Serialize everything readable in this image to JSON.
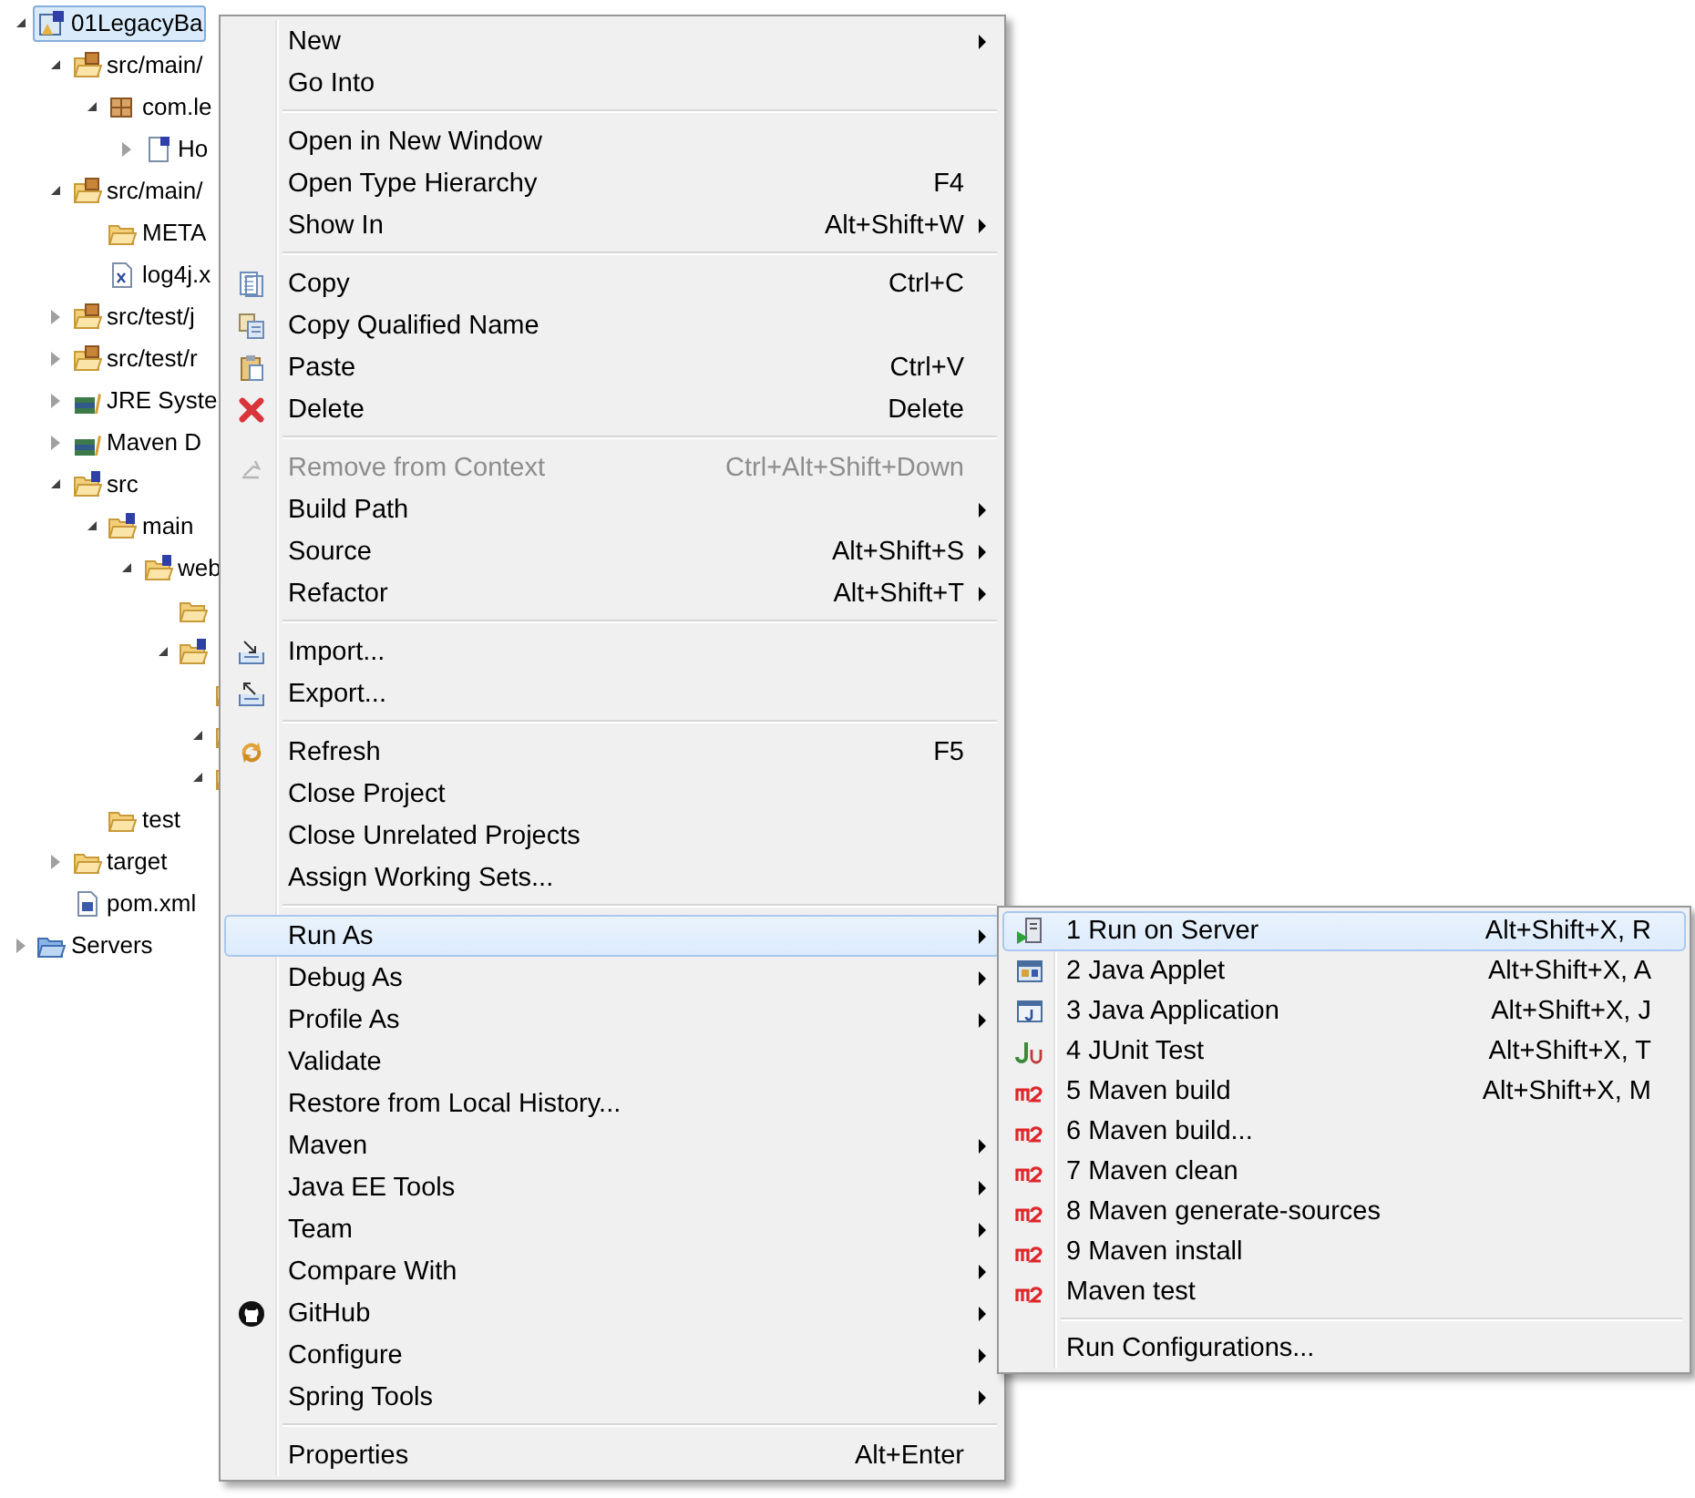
{
  "tree": [
    {
      "label": "01LegacyBa",
      "kind": "project",
      "expanded": true,
      "selected": true,
      "children": [
        {
          "label": "src/main/",
          "kind": "package-folder",
          "expanded": true,
          "selected": false,
          "children": [
            {
              "label": "com.le",
              "kind": "package",
              "expanded": true,
              "selected": false,
              "children": [
                {
                  "label": "Ho",
                  "kind": "java-file",
                  "expanded": false,
                  "selected": false
                }
              ]
            }
          ]
        },
        {
          "label": "src/main/",
          "kind": "package-folder",
          "expanded": true,
          "selected": false,
          "children": [
            {
              "label": "META",
              "kind": "folder",
              "selected": false
            },
            {
              "label": "log4j.x",
              "kind": "xml-file",
              "selected": false
            }
          ]
        },
        {
          "label": "src/test/j",
          "kind": "package-folder",
          "expanded": false,
          "selected": false
        },
        {
          "label": "src/test/r",
          "kind": "package-folder",
          "expanded": false,
          "selected": false
        },
        {
          "label": "JRE Syste",
          "kind": "library",
          "expanded": false,
          "selected": false
        },
        {
          "label": "Maven D",
          "kind": "library",
          "expanded": false,
          "selected": false
        },
        {
          "label": "src",
          "kind": "spring-folder",
          "expanded": true,
          "selected": false,
          "children": [
            {
              "label": "main",
              "kind": "spring-folder",
              "expanded": true,
              "selected": false,
              "children": [
                {
                  "label": "web",
                  "kind": "spring-folder",
                  "expanded": true,
                  "selected": false,
                  "children": [
                    {
                      "kind": "folder",
                      "selected": false
                    },
                    {
                      "kind": "spring-folder",
                      "expanded": true,
                      "selected": false,
                      "children": [
                        {
                          "kind": "folder",
                          "selected": false
                        },
                        {
                          "kind": "folder",
                          "expanded": true,
                          "selected": false
                        },
                        {
                          "kind": "folder",
                          "expanded": true,
                          "selected": false
                        }
                      ]
                    }
                  ]
                }
              ]
            },
            {
              "label": "test",
              "kind": "folder",
              "selected": false
            }
          ]
        },
        {
          "label": "target",
          "kind": "folder",
          "expanded": false,
          "selected": false
        },
        {
          "label": "pom.xml",
          "kind": "maven-file",
          "selected": false
        }
      ]
    },
    {
      "label": "Servers",
      "kind": "server-folder",
      "expanded": false,
      "selected": false
    }
  ],
  "menu": {
    "groups": [
      [
        {
          "label": "New",
          "submenu": true,
          "disabled": false,
          "selected": false
        },
        {
          "label": "Go Into",
          "submenu": false,
          "disabled": false,
          "selected": false
        }
      ],
      [
        {
          "label": "Open in New Window",
          "submenu": false,
          "disabled": false,
          "selected": false
        },
        {
          "label": "Open Type Hierarchy",
          "shortcut": "F4",
          "submenu": false,
          "disabled": false,
          "selected": false
        },
        {
          "label": "Show In",
          "shortcut": "Alt+Shift+W",
          "submenu": true,
          "disabled": false,
          "selected": false
        }
      ],
      [
        {
          "label": "Copy",
          "shortcut": "Ctrl+C",
          "kind": "copy",
          "submenu": false,
          "disabled": false,
          "selected": false
        },
        {
          "label": "Copy Qualified Name",
          "kind": "copy-name",
          "submenu": false,
          "disabled": false,
          "selected": false
        },
        {
          "label": "Paste",
          "shortcut": "Ctrl+V",
          "kind": "paste",
          "submenu": false,
          "disabled": false,
          "selected": false
        },
        {
          "label": "Delete",
          "shortcut": "Delete",
          "kind": "delete",
          "submenu": false,
          "disabled": false,
          "selected": false
        }
      ],
      [
        {
          "label": "Remove from Context",
          "shortcut": "Ctrl+Alt+Shift+Down",
          "kind": "remove",
          "submenu": false,
          "disabled": true,
          "selected": false
        },
        {
          "label": "Build Path",
          "submenu": true,
          "disabled": false,
          "selected": false
        },
        {
          "label": "Source",
          "shortcut": "Alt+Shift+S",
          "submenu": true,
          "disabled": false,
          "selected": false
        },
        {
          "label": "Refactor",
          "shortcut": "Alt+Shift+T",
          "submenu": true,
          "disabled": false,
          "selected": false
        }
      ],
      [
        {
          "label": "Import...",
          "kind": "import",
          "submenu": false,
          "disabled": false,
          "selected": false
        },
        {
          "label": "Export...",
          "kind": "export",
          "submenu": false,
          "disabled": false,
          "selected": false
        }
      ],
      [
        {
          "label": "Refresh",
          "shortcut": "F5",
          "kind": "refresh",
          "submenu": false,
          "disabled": false,
          "selected": false
        },
        {
          "label": "Close Project",
          "submenu": false,
          "disabled": false,
          "selected": false
        },
        {
          "label": "Close Unrelated Projects",
          "submenu": false,
          "disabled": false,
          "selected": false
        },
        {
          "label": "Assign Working Sets...",
          "submenu": false,
          "disabled": false,
          "selected": false
        }
      ],
      [
        {
          "label": "Run As",
          "submenu": true,
          "disabled": false,
          "selected": true
        },
        {
          "label": "Debug As",
          "submenu": true,
          "disabled": false,
          "selected": false
        },
        {
          "label": "Profile As",
          "submenu": true,
          "disabled": false,
          "selected": false
        },
        {
          "label": "Validate",
          "submenu": false,
          "disabled": false,
          "selected": false
        },
        {
          "label": "Restore from Local History...",
          "submenu": false,
          "disabled": false,
          "selected": false
        },
        {
          "label": "Maven",
          "submenu": true,
          "disabled": false,
          "selected": false
        },
        {
          "label": "Java EE Tools",
          "submenu": true,
          "disabled": false,
          "selected": false
        },
        {
          "label": "Team",
          "submenu": true,
          "disabled": false,
          "selected": false
        },
        {
          "label": "Compare With",
          "submenu": true,
          "disabled": false,
          "selected": false
        },
        {
          "label": "GitHub",
          "kind": "github",
          "submenu": true,
          "disabled": false,
          "selected": false
        },
        {
          "label": "Configure",
          "submenu": true,
          "disabled": false,
          "selected": false
        },
        {
          "label": "Spring Tools",
          "submenu": true,
          "disabled": false,
          "selected": false
        }
      ],
      [
        {
          "label": "Properties",
          "shortcut": "Alt+Enter",
          "submenu": false,
          "disabled": false,
          "selected": false
        }
      ]
    ]
  },
  "run_as_submenu": {
    "groups": [
      [
        {
          "label": "1 Run on Server",
          "shortcut": "Alt+Shift+X, R",
          "kind": "server-run",
          "selected": true
        },
        {
          "label": "2 Java Applet",
          "shortcut": "Alt+Shift+X, A",
          "kind": "applet",
          "selected": false
        },
        {
          "label": "3 Java Application",
          "shortcut": "Alt+Shift+X, J",
          "kind": "java-app",
          "selected": false
        },
        {
          "label": "4 JUnit Test",
          "shortcut": "Alt+Shift+X, T",
          "kind": "junit",
          "selected": false
        },
        {
          "label": "5 Maven build",
          "shortcut": "Alt+Shift+X, M",
          "kind": "m2",
          "selected": false
        },
        {
          "label": "6 Maven build...",
          "kind": "m2",
          "selected": false
        },
        {
          "label": "7 Maven clean",
          "kind": "m2",
          "selected": false
        },
        {
          "label": "8 Maven generate-sources",
          "kind": "m2",
          "selected": false
        },
        {
          "label": "9 Maven install",
          "kind": "m2",
          "selected": false
        },
        {
          "label": "Maven test",
          "kind": "m2",
          "selected": false
        }
      ],
      [
        {
          "label": "Run Configurations...",
          "selected": false
        }
      ]
    ]
  }
}
